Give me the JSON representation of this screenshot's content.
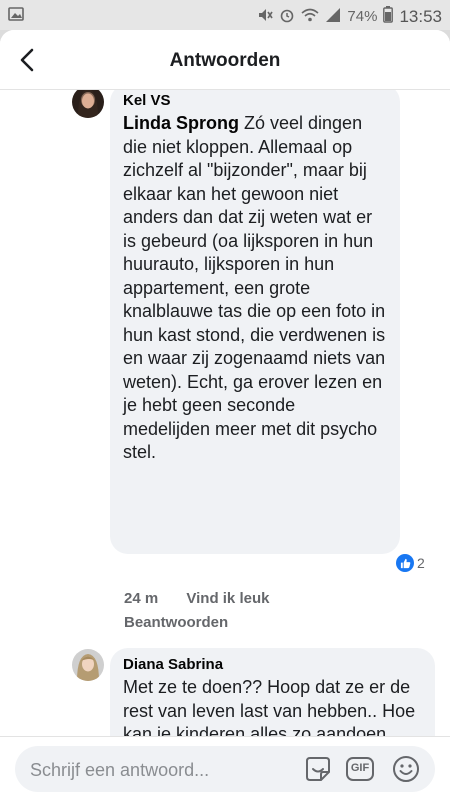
{
  "status_bar": {
    "battery": "74%",
    "time": "13:53",
    "icons": [
      "image-notification-icon",
      "mute-icon",
      "alarm-icon",
      "wifi-icon",
      "signal-icon",
      "battery-icon"
    ]
  },
  "header": {
    "title": "Antwoorden",
    "back_icon": "chevron-left-icon"
  },
  "comments": [
    {
      "author": "Kel VS",
      "mention": "Linda Sprong",
      "text": " Zó veel dingen die niet kloppen. Allemaal op zichzelf al \"bijzonder\", maar bij elkaar kan het gewoon niet anders dan dat zij weten wat er is gebeurd (oa lijksporen in hun huurauto, lijksporen in hun appartement, een grote knalblauwe tas die op een foto in hun kast stond, die verdwenen is en waar zij zogenaamd niets van weten). Echt, ga erover lezen en je hebt geen seconde medelijden meer met dit psycho stel.",
      "reaction_count": "2",
      "time": "24 m",
      "like_label": "Vind ik leuk",
      "reply_label": "Beantwoorden"
    },
    {
      "author": "Diana Sabrina",
      "text": "Met ze te doen?? Hoop dat ze er de rest van leven last van hebben.. Hoe kan je kinderen alles zo aandoen...."
    }
  ],
  "composer": {
    "placeholder": "Schrijf een antwoord...",
    "gif_label": "GIF"
  },
  "colors": {
    "accent": "#1877f2",
    "bubble": "#f0f2f5",
    "meta_text": "#65676b"
  }
}
